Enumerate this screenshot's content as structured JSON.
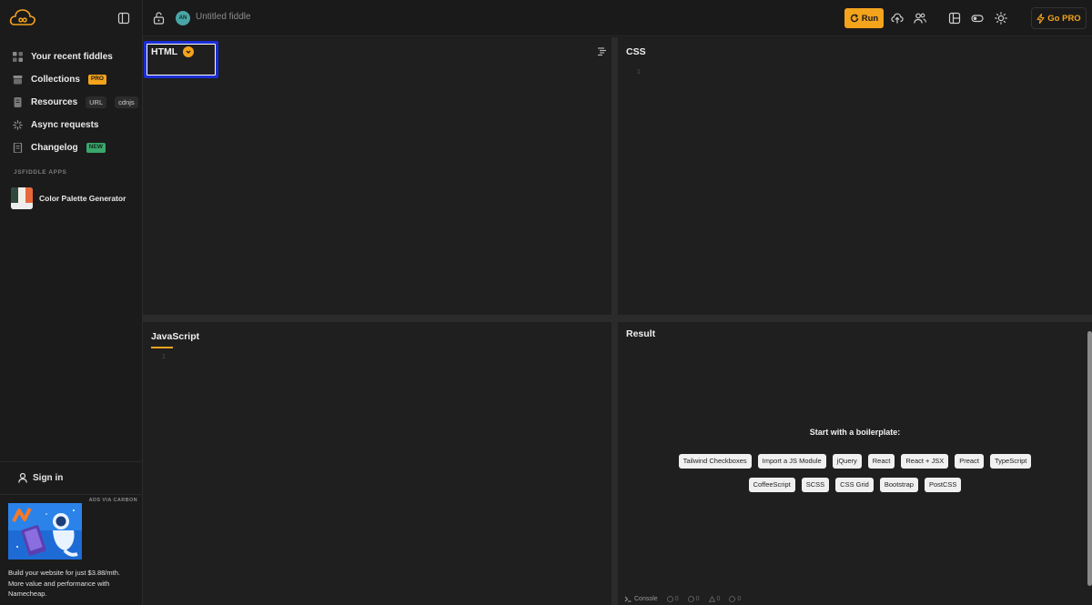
{
  "sidebar": {
    "nav_items": [
      {
        "label": "Your recent fiddles",
        "icon": "grid-icon"
      },
      {
        "label": "Collections",
        "icon": "archive-icon",
        "badge": "PRO"
      },
      {
        "label": "Resources",
        "icon": "file-stack-icon",
        "chips": [
          "URL",
          "cdnjs"
        ]
      },
      {
        "label": "Async requests",
        "icon": "spinner-icon"
      },
      {
        "label": "Changelog",
        "icon": "document-icon",
        "badge": "NEW"
      }
    ],
    "apps_section_label": "JSFIDDLE APPS",
    "apps": [
      {
        "label": "Color Palette Generator"
      }
    ],
    "signin_label": "Sign in",
    "ad": {
      "label": "ADS VIA CARBON",
      "text": "Build your website for just $3.88/mth. More value and performance with Namecheap."
    }
  },
  "topbar": {
    "avatar_initials": "AN",
    "fiddle_title": "Untitled fiddle",
    "run_label": "Run",
    "gopro_label": "Go PRO"
  },
  "panels": {
    "html": {
      "title": "HTML",
      "line": "1"
    },
    "css": {
      "title": "CSS",
      "line": "1"
    },
    "js": {
      "title": "JavaScript",
      "line": "1"
    },
    "result": {
      "title": "Result",
      "boilerplate_title": "Start with a boilerplate:",
      "row1": [
        "Tailwind Checkboxes",
        "Import a JS Module",
        "jQuery",
        "React",
        "React + JSX",
        "Preact",
        "TypeScript"
      ],
      "row2": [
        "CoffeeScript",
        "SCSS",
        "CSS Grid",
        "Bootstrap",
        "PostCSS"
      ],
      "console_label": "Console",
      "console_counts": [
        "0",
        "0",
        "0",
        "0"
      ]
    }
  },
  "colors": {
    "accent": "#f4a31c",
    "highlight": "#1b2dd6",
    "background": "#1a1a1a",
    "panel": "#1f1f1f"
  }
}
